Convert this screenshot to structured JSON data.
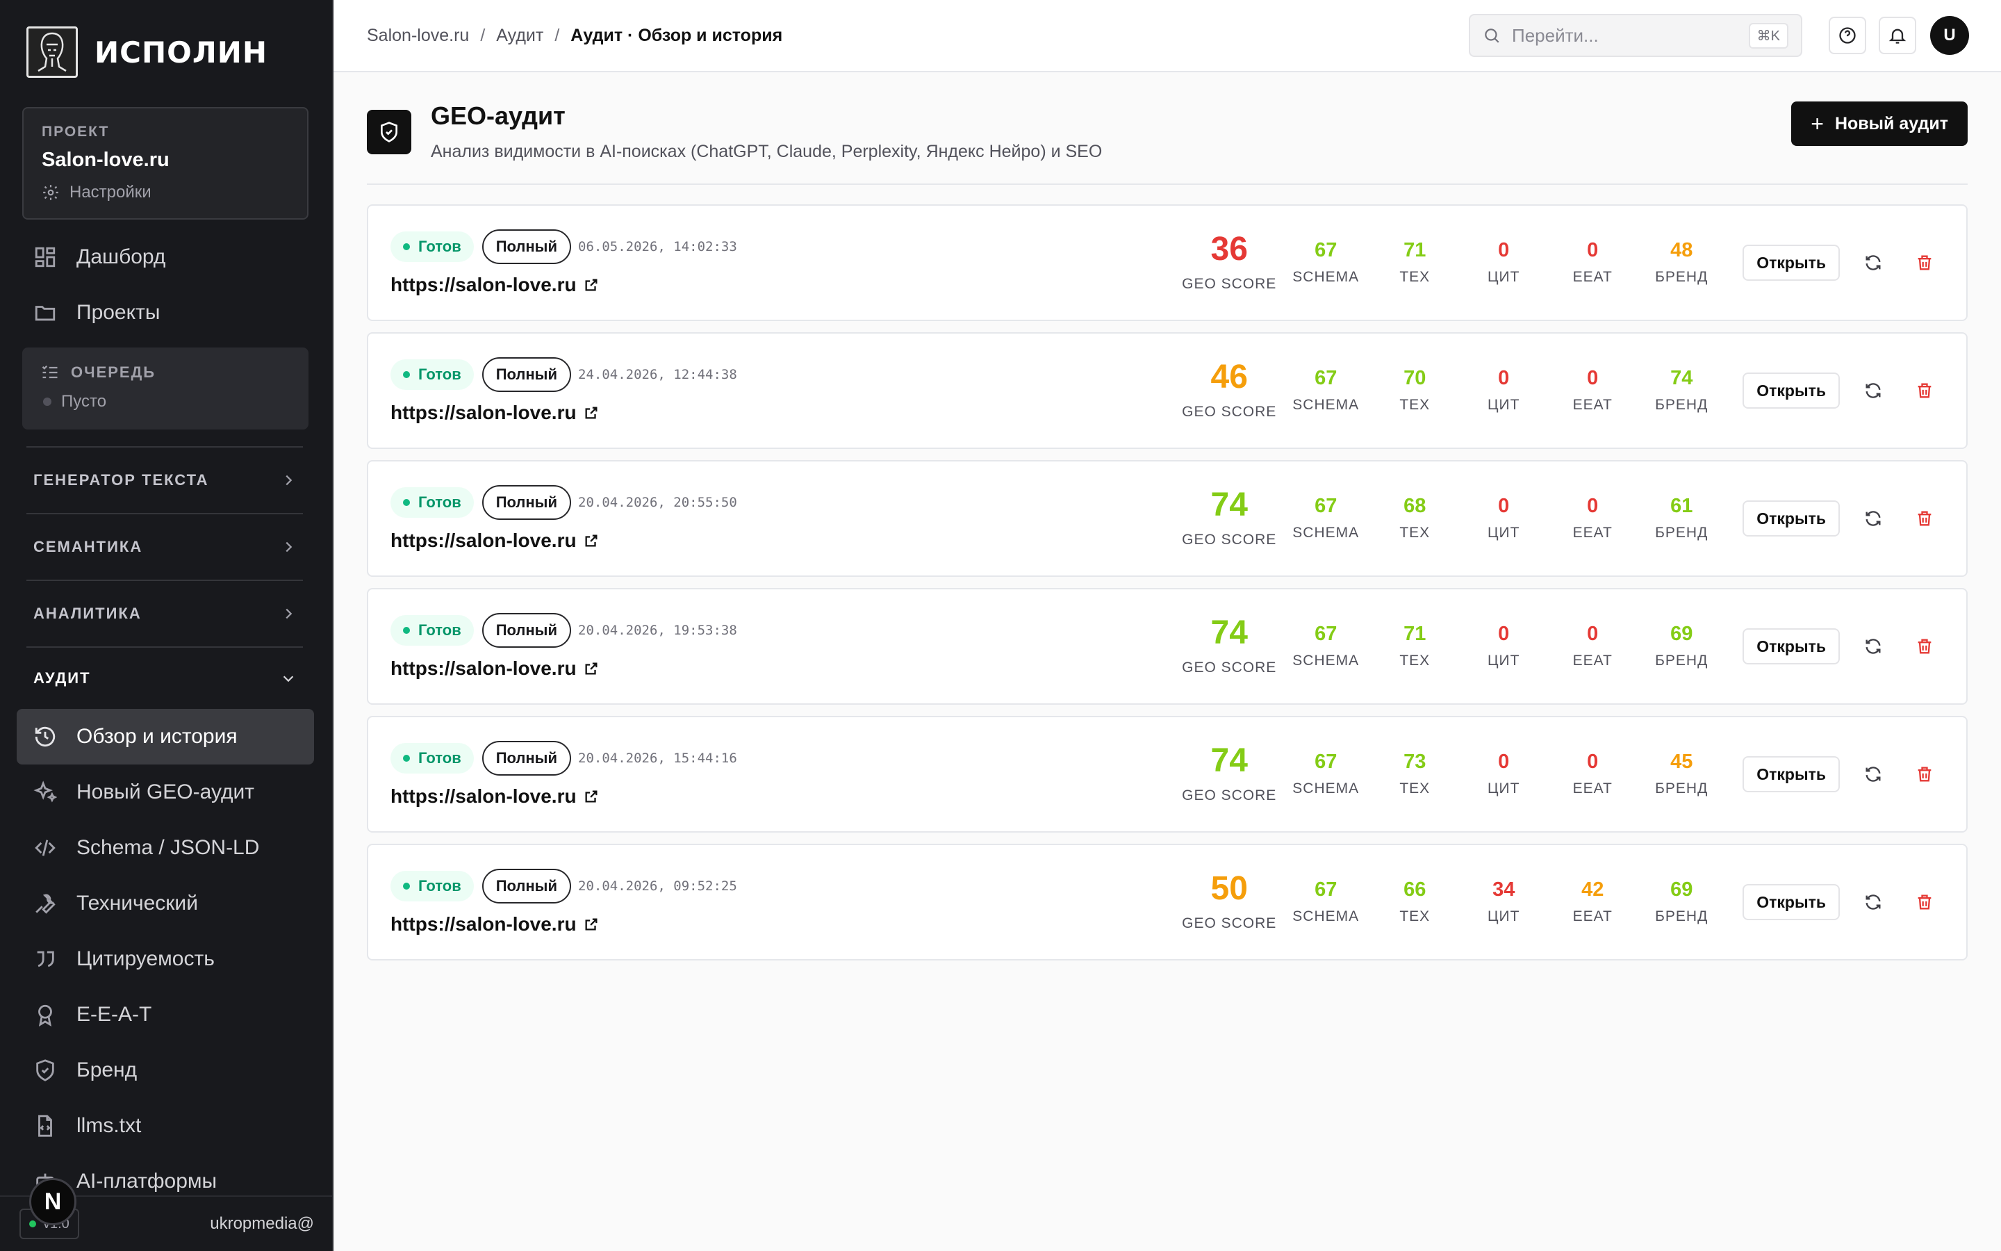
{
  "sidebar": {
    "brand": "ИСПОЛИН",
    "project": {
      "label": "ПРОЕКТ",
      "name": "Salon-love.ru",
      "settings": "Настройки"
    },
    "nav": [
      {
        "label": "Дашборд",
        "icon": "dashboard-icon"
      },
      {
        "label": "Проекты",
        "icon": "folder-icon"
      }
    ],
    "queue": {
      "title": "ОЧЕРЕДЬ",
      "status": "Пусто"
    },
    "sections": [
      {
        "label": "ГЕНЕРАТОР ТЕКСТА"
      },
      {
        "label": "СЕМАНТИКА"
      },
      {
        "label": "АНАЛИТИКА"
      },
      {
        "label": "АУДИТ"
      }
    ],
    "audit_items": [
      {
        "label": "Обзор и история",
        "icon": "history-icon",
        "active": true
      },
      {
        "label": "Новый GEO-аудит",
        "icon": "sparkles-icon"
      },
      {
        "label": "Schema / JSON-LD",
        "icon": "code-icon"
      },
      {
        "label": "Технический",
        "icon": "wrench-icon"
      },
      {
        "label": "Цитируемость",
        "icon": "quote-icon"
      },
      {
        "label": "E-E-A-T",
        "icon": "award-icon"
      },
      {
        "label": "Бренд",
        "icon": "shield-icon"
      },
      {
        "label": "llms.txt",
        "icon": "file-code-icon"
      },
      {
        "label": "AI-платформы",
        "icon": "bot-icon"
      }
    ],
    "footer": {
      "version": "v1.0",
      "user": "ukropmedia@"
    },
    "n_badge": "N"
  },
  "topbar": {
    "breadcrumb": [
      "Salon-love.ru",
      "Аудит",
      "Аудит · Обзор и история"
    ],
    "search_placeholder": "Перейти...",
    "search_shortcut": "⌘K",
    "avatar": "U"
  },
  "page": {
    "title": "GEO-аудит",
    "subtitle": "Анализ видимости в AI-поисках (ChatGPT, Claude, Perplexity, Яндекс Нейро) и SEO",
    "new_button": "Новый аудит"
  },
  "labels": {
    "status": "Готов",
    "type": "Полный",
    "geo_score": "GEO SCORE",
    "schema": "SCHEMA",
    "tex": "ТЕХ",
    "cit": "ЦИТ",
    "eeat": "EEAT",
    "brand": "БРЕНД",
    "open": "Открыть"
  },
  "colors": {
    "red": "#e53935",
    "orange": "#f59e0b",
    "green": "#84cc16",
    "ready": "#059669"
  },
  "audits": [
    {
      "date": "06.05.2026, 14:02:33",
      "url": "https://salon-love.ru",
      "geo": "36",
      "geo_c": "red",
      "schema": "67",
      "schema_c": "green",
      "tex": "71",
      "tex_c": "green",
      "cit": "0",
      "cit_c": "red",
      "eeat": "0",
      "eeat_c": "red",
      "brand": "48",
      "brand_c": "orange"
    },
    {
      "date": "24.04.2026, 12:44:38",
      "url": "https://salon-love.ru",
      "geo": "46",
      "geo_c": "orange",
      "schema": "67",
      "schema_c": "green",
      "tex": "70",
      "tex_c": "green",
      "cit": "0",
      "cit_c": "red",
      "eeat": "0",
      "eeat_c": "red",
      "brand": "74",
      "brand_c": "green"
    },
    {
      "date": "20.04.2026, 20:55:50",
      "url": "https://salon-love.ru",
      "geo": "74",
      "geo_c": "green",
      "schema": "67",
      "schema_c": "green",
      "tex": "68",
      "tex_c": "green",
      "cit": "0",
      "cit_c": "red",
      "eeat": "0",
      "eeat_c": "red",
      "brand": "61",
      "brand_c": "green"
    },
    {
      "date": "20.04.2026, 19:53:38",
      "url": "https://salon-love.ru",
      "geo": "74",
      "geo_c": "green",
      "schema": "67",
      "schema_c": "green",
      "tex": "71",
      "tex_c": "green",
      "cit": "0",
      "cit_c": "red",
      "eeat": "0",
      "eeat_c": "red",
      "brand": "69",
      "brand_c": "green"
    },
    {
      "date": "20.04.2026, 15:44:16",
      "url": "https://salon-love.ru",
      "geo": "74",
      "geo_c": "green",
      "schema": "67",
      "schema_c": "green",
      "tex": "73",
      "tex_c": "green",
      "cit": "0",
      "cit_c": "red",
      "eeat": "0",
      "eeat_c": "red",
      "brand": "45",
      "brand_c": "orange"
    },
    {
      "date": "20.04.2026, 09:52:25",
      "url": "https://salon-love.ru",
      "geo": "50",
      "geo_c": "orange",
      "schema": "67",
      "schema_c": "green",
      "tex": "66",
      "tex_c": "green",
      "cit": "34",
      "cit_c": "red",
      "eeat": "42",
      "eeat_c": "orange",
      "brand": "69",
      "brand_c": "green"
    }
  ]
}
